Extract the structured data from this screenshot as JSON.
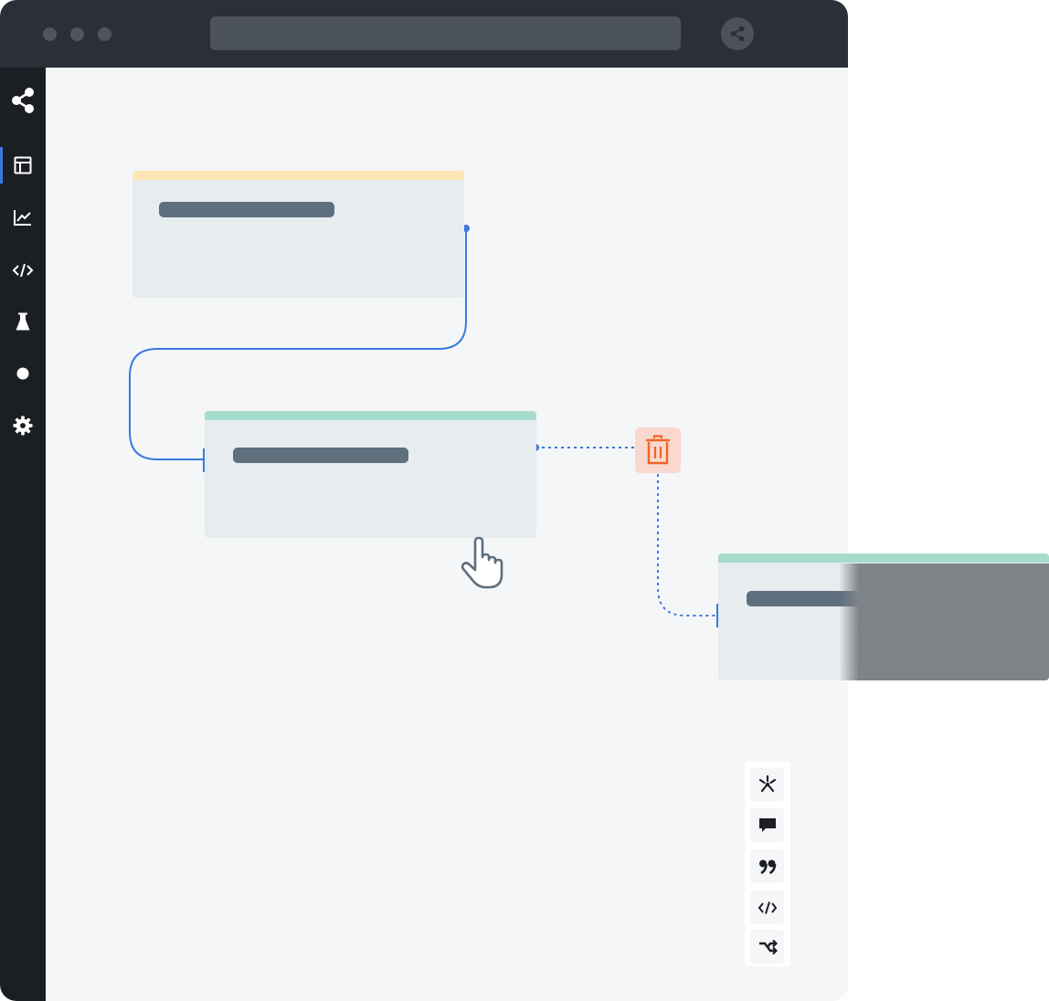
{
  "window": {
    "title_bar": {
      "address_text": ""
    }
  },
  "sidebar": {
    "items": [
      {
        "name": "share-icon",
        "active": false
      },
      {
        "name": "layout-icon",
        "active": true
      },
      {
        "name": "line-chart-icon",
        "active": false
      },
      {
        "name": "code-icon",
        "active": false
      },
      {
        "name": "flask-icon",
        "active": false
      },
      {
        "name": "circle-icon",
        "active": false
      },
      {
        "name": "gear-icon",
        "active": false
      }
    ]
  },
  "canvas": {
    "nodes": [
      {
        "id": "node-1",
        "header_color": "#fde6b4",
        "label": ""
      },
      {
        "id": "node-2",
        "header_color": "#a6dccc",
        "label": ""
      },
      {
        "id": "node-3",
        "header_color": "#a6dccc",
        "label": ""
      }
    ],
    "connections": [
      {
        "from": "node-1",
        "to": "node-2",
        "style": "solid"
      },
      {
        "from": "node-2",
        "to": "node-3",
        "style": "dashed",
        "selected": true
      }
    ],
    "delete_action_icon": "trash-icon"
  },
  "toolbar": {
    "tools": [
      {
        "name": "spark-icon"
      },
      {
        "name": "comment-icon"
      },
      {
        "name": "quote-icon"
      },
      {
        "name": "code-icon"
      },
      {
        "name": "branch-icon"
      }
    ]
  },
  "colors": {
    "accent": "#3b79e0",
    "danger": "#f06424",
    "danger_bg": "#f9d9cf",
    "sidebar_bg": "#1b1e23",
    "titlebar_bg": "#2b2f38",
    "canvas_bg": "#f4f6f8"
  }
}
